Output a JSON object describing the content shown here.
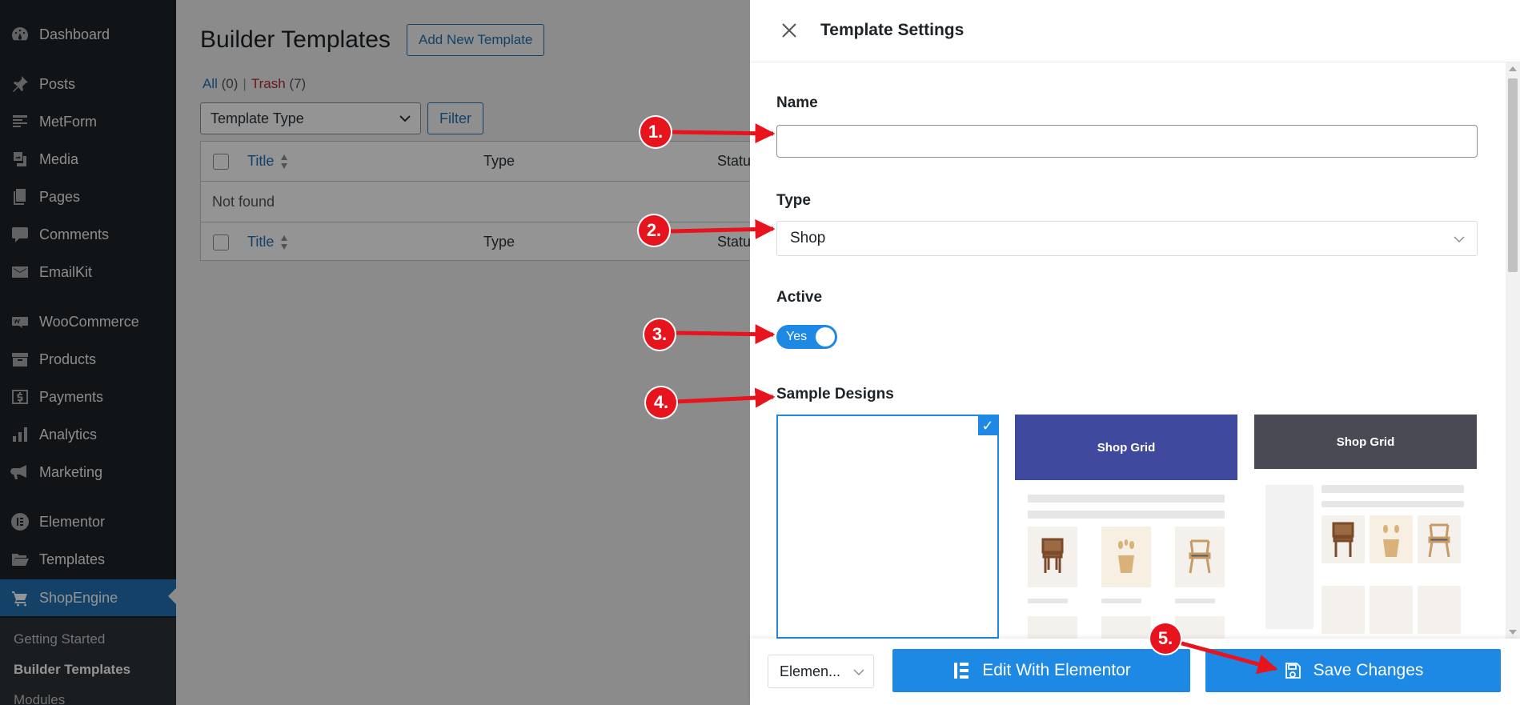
{
  "sidebar": {
    "items": [
      {
        "label": "Dashboard",
        "icon": "dashboard-icon"
      },
      {
        "label": "Posts",
        "icon": "pin-icon"
      },
      {
        "label": "MetForm",
        "icon": "form-icon"
      },
      {
        "label": "Media",
        "icon": "media-icon"
      },
      {
        "label": "Pages",
        "icon": "pages-icon"
      },
      {
        "label": "Comments",
        "icon": "comment-icon"
      },
      {
        "label": "EmailKit",
        "icon": "mail-icon"
      },
      {
        "label": "WooCommerce",
        "icon": "woo-icon"
      },
      {
        "label": "Products",
        "icon": "archive-icon"
      },
      {
        "label": "Payments",
        "icon": "dollar-icon"
      },
      {
        "label": "Analytics",
        "icon": "chart-bar-icon"
      },
      {
        "label": "Marketing",
        "icon": "megaphone-icon"
      },
      {
        "label": "Elementor",
        "icon": "elementor-icon"
      },
      {
        "label": "Templates",
        "icon": "folder-icon"
      },
      {
        "label": "ShopEngine",
        "icon": "shopengine-icon"
      }
    ],
    "submenu": [
      "Getting Started",
      "Builder Templates",
      "Modules"
    ]
  },
  "main": {
    "page_title": "Builder Templates",
    "add_new": "Add New Template",
    "views": {
      "all": "All",
      "all_count": "(0)",
      "sep": "|",
      "trash": "Trash",
      "trash_count": "(7)"
    },
    "type_filter": "Template Type",
    "filter_button": "Filter",
    "table": {
      "col_title": "Title",
      "col_type": "Type",
      "col_status": "Statu",
      "empty": "Not found"
    }
  },
  "drawer": {
    "title": "Template Settings",
    "name_label": "Name",
    "name_value": "",
    "type_label": "Type",
    "type_value": "Shop",
    "active_label": "Active",
    "active_toggle": "Yes",
    "sample_label": "Sample Designs",
    "designs": [
      {
        "title": ""
      },
      {
        "title": "Shop Grid"
      },
      {
        "title": "Shop Grid"
      }
    ],
    "editor_select": "Elemen...",
    "edit_button": "Edit With Elementor",
    "save_button": "Save Changes"
  },
  "annotations": [
    "1.",
    "2.",
    "3.",
    "4.",
    "5."
  ],
  "colors": {
    "accent": "#1e88e5",
    "wp_blue": "#2271b1",
    "annotation_red": "#e8141d",
    "sidebar": "#1d2327"
  }
}
